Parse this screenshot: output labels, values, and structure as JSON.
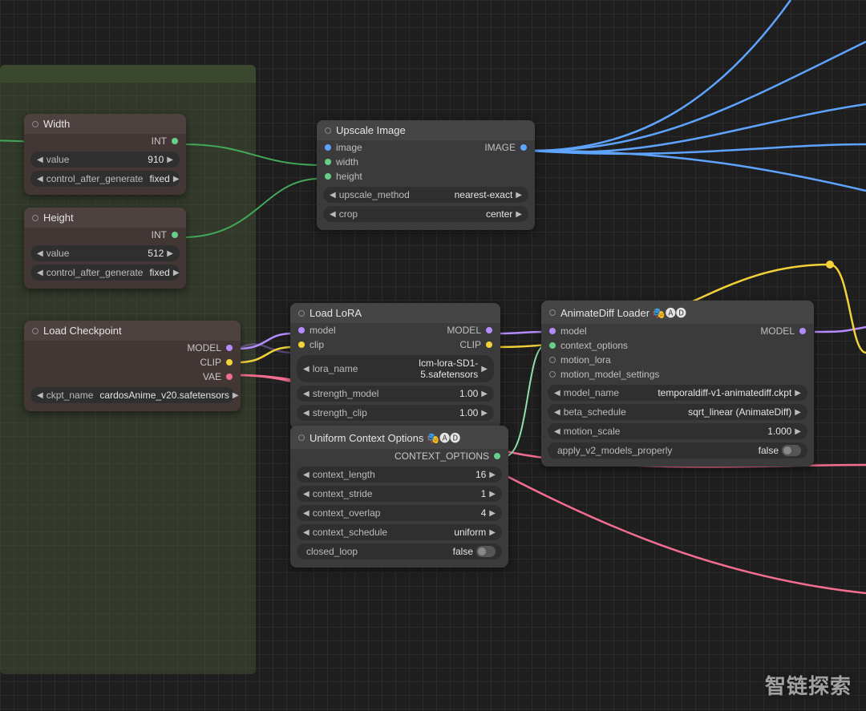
{
  "colors": {
    "model": "#b58cff",
    "clip": "#f2d23a",
    "vae": "#f26d8f",
    "image": "#5ea4ff",
    "int": "#66d08b",
    "ctx": "#66d08b"
  },
  "labels": {
    "INT": "INT",
    "IMAGE": "IMAGE",
    "MODEL": "MODEL",
    "CLIP": "CLIP",
    "VAE": "VAE",
    "CONTEXT_OPTIONS": "CONTEXT_OPTIONS"
  },
  "nodes": {
    "width": {
      "title": "Width",
      "value": "910",
      "control_label": "control_after_generate",
      "control_value": "fixed",
      "widget_value_label": "value"
    },
    "height": {
      "title": "Height",
      "value": "512",
      "control_label": "control_after_generate",
      "control_value": "fixed",
      "widget_value_label": "value"
    },
    "loadckpt": {
      "title": "Load Checkpoint",
      "ckpt_label": "ckpt_name",
      "ckpt_value": "cardosAnime_v20.safetensors"
    },
    "upscale": {
      "title": "Upscale Image",
      "in_image": "image",
      "in_width": "width",
      "in_height": "height",
      "method_label": "upscale_method",
      "method_value": "nearest-exact",
      "crop_label": "crop",
      "crop_value": "center"
    },
    "lora": {
      "title": "Load LoRA",
      "in_model": "model",
      "in_clip": "clip",
      "name_label": "lora_name",
      "name_value": "lcm-lora-SD1-5.safetensors",
      "smodel_label": "strength_model",
      "smodel_value": "1.00",
      "sclip_label": "strength_clip",
      "sclip_value": "1.00"
    },
    "ctx": {
      "title": "Uniform Context Options 🎭🅐🅓",
      "len_label": "context_length",
      "len_value": "16",
      "stride_label": "context_stride",
      "stride_value": "1",
      "overlap_label": "context_overlap",
      "overlap_value": "4",
      "sched_label": "context_schedule",
      "sched_value": "uniform",
      "loop_label": "closed_loop",
      "loop_value": "false"
    },
    "anim": {
      "title": "AnimateDiff Loader 🎭🅐🅓",
      "in_model": "model",
      "in_ctx": "context_options",
      "in_lora": "motion_lora",
      "in_mms": "motion_model_settings",
      "mname_label": "model_name",
      "mname_value": "temporaldiff-v1-animatediff.ckpt",
      "beta_label": "beta_schedule",
      "beta_value": "sqrt_linear (AnimateDiff)",
      "scale_label": "motion_scale",
      "scale_value": "1.000",
      "v2_label": "apply_v2_models_properly",
      "v2_value": "false"
    }
  },
  "watermark": "智链探索"
}
